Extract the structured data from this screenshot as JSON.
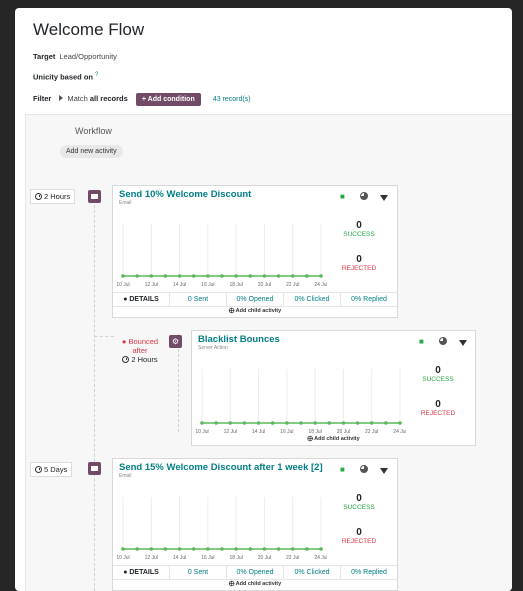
{
  "page": {
    "title": "Welcome Flow",
    "target_label": "Target",
    "target_value": "Lead/Opportunity",
    "unicity_label": "Unicity based on",
    "unicity_help": "?",
    "filter_label": "Filter",
    "filter_match": "Match",
    "filter_records": "all records",
    "add_condition": "+ Add condition",
    "record_count": "43 record(s)"
  },
  "workflow": {
    "label": "Workflow",
    "add_activity": "Add new activity"
  },
  "activities": [
    {
      "delay": "2 Hours",
      "title": "Send 10% Welcome Discount",
      "subtitle": "Email",
      "success_count": "0",
      "success_label": "SUCCESS",
      "rejected_count": "0",
      "rejected_label": "REJECTED",
      "details": "DETAILS",
      "sent": "0 Sent",
      "opened": "0% Opened",
      "clicked": "0% Clicked",
      "replied": "0% Replied",
      "add_child": "Add child activity"
    },
    {
      "trigger_line1": "Bounced",
      "trigger_line2": "after",
      "delay": "2 Hours",
      "title": "Blacklist Bounces",
      "subtitle": "Server Action",
      "success_count": "0",
      "success_label": "SUCCESS",
      "rejected_count": "0",
      "rejected_label": "REJECTED",
      "add_child": "Add child activity"
    },
    {
      "delay": "5 Days",
      "title": "Send 15% Welcome Discount after 1 week [2]",
      "subtitle": "Email",
      "success_count": "0",
      "success_label": "SUCCESS",
      "rejected_count": "0",
      "rejected_label": "REJECTED",
      "details": "DETAILS",
      "sent": "0 Sent",
      "opened": "0% Opened",
      "clicked": "0% Clicked",
      "replied": "0% Replied",
      "add_child": "Add child activity"
    }
  ],
  "colors": {
    "brand": "#714b67",
    "teal": "#017e84",
    "success": "#28a745",
    "danger": "#dc3545",
    "series": "#5cb85c"
  },
  "chart_data": [
    {
      "type": "line",
      "x": [
        "10 Jul",
        "11 Jul",
        "12 Jul",
        "13 Jul",
        "14 Jul",
        "15 Jul",
        "16 Jul",
        "17 Jul",
        "18 Jul",
        "19 Jul",
        "20 Jul",
        "21 Jul",
        "22 Jul",
        "23 Jul",
        "24 Jul"
      ],
      "tick_labels": [
        "10 Jul",
        "12 Jul",
        "14 Jul",
        "16 Jul",
        "18 Jul",
        "20 Jul",
        "22 Jul",
        "24 Jul"
      ],
      "series": [
        {
          "values": [
            0,
            0,
            0,
            0,
            0,
            0,
            0,
            0,
            0,
            0,
            0,
            0,
            0,
            0,
            0
          ]
        }
      ]
    },
    {
      "type": "line",
      "x": [
        "10 Jul",
        "11 Jul",
        "12 Jul",
        "13 Jul",
        "14 Jul",
        "15 Jul",
        "16 Jul",
        "17 Jul",
        "18 Jul",
        "19 Jul",
        "20 Jul",
        "21 Jul",
        "22 Jul",
        "23 Jul",
        "24 Jul"
      ],
      "tick_labels": [
        "10 Jul",
        "12 Jul",
        "14 Jul",
        "16 Jul",
        "18 Jul",
        "20 Jul",
        "22 Jul",
        "24 Jul"
      ],
      "series": [
        {
          "values": [
            0,
            0,
            0,
            0,
            0,
            0,
            0,
            0,
            0,
            0,
            0,
            0,
            0,
            0,
            0
          ]
        }
      ]
    },
    {
      "type": "line",
      "x": [
        "10 Jul",
        "11 Jul",
        "12 Jul",
        "13 Jul",
        "14 Jul",
        "15 Jul",
        "16 Jul",
        "17 Jul",
        "18 Jul",
        "19 Jul",
        "20 Jul",
        "21 Jul",
        "22 Jul",
        "23 Jul",
        "24 Jul"
      ],
      "tick_labels": [
        "10 Jul",
        "12 Jul",
        "14 Jul",
        "16 Jul",
        "18 Jul",
        "20 Jul",
        "22 Jul",
        "24 Jul"
      ],
      "series": [
        {
          "values": [
            0,
            0,
            0,
            0,
            0,
            0,
            0,
            0,
            0,
            0,
            0,
            0,
            0,
            0,
            0
          ]
        }
      ]
    }
  ]
}
